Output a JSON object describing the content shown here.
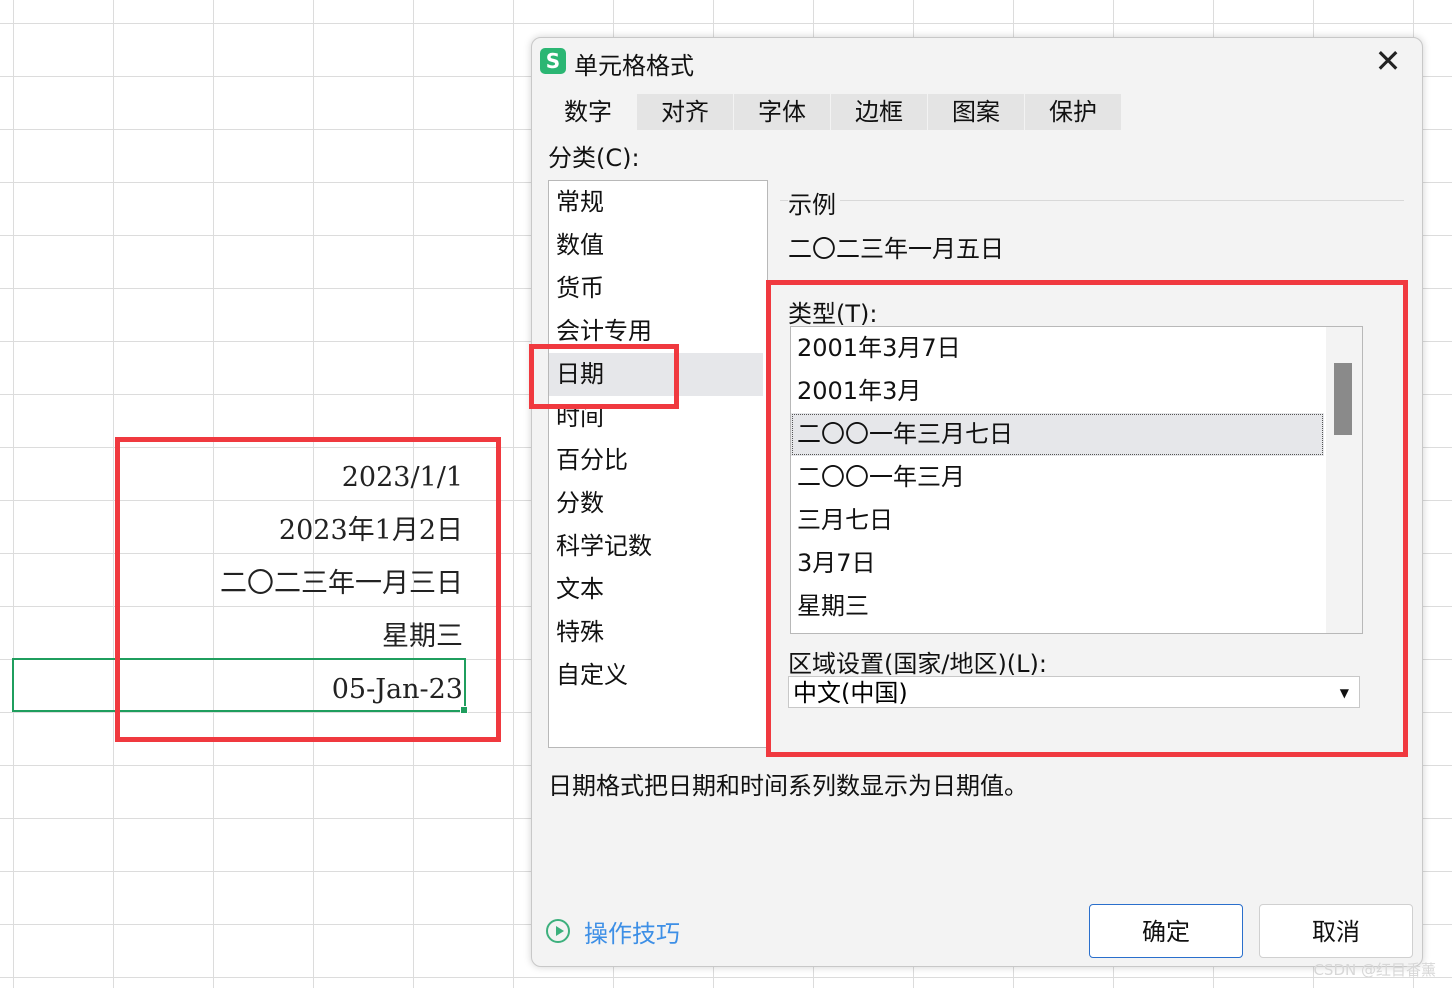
{
  "sheet": {
    "cells": [
      "2023/1/1",
      "2023年1月2日",
      "二〇二三年一月三日",
      "星期三",
      "05-Jan-23"
    ]
  },
  "dialog": {
    "app_icon": "S",
    "title": "单元格格式",
    "close": "✕",
    "tabs": [
      "数字",
      "对齐",
      "字体",
      "边框",
      "图案",
      "保护"
    ],
    "category_label": "分类(C):",
    "categories": [
      "常规",
      "数值",
      "货币",
      "会计专用",
      "日期",
      "时间",
      "百分比",
      "分数",
      "科学记数",
      "文本",
      "特殊",
      "自定义"
    ],
    "sample_label": "示例",
    "sample_value": "二〇二三年一月五日",
    "type_label": "类型(T):",
    "types": [
      "2001年3月7日",
      "2001年3月",
      "二〇〇一年三月七日",
      "二〇〇一年三月",
      "三月七日",
      "3月7日",
      "星期三"
    ],
    "region_label": "区域设置(国家/地区)(L):",
    "region_value": "中文(中国)",
    "description": "日期格式把日期和时间系列数显示为日期值。",
    "tips": "操作技巧",
    "ok": "确定",
    "cancel": "取消"
  },
  "watermark": "CSDN @红目香薰",
  "colors": {
    "highlight_red": "#f0393f",
    "active_cell_green": "#1f9e5e",
    "link_blue": "#3d8fe6",
    "ok_border": "#2a6fcc"
  }
}
